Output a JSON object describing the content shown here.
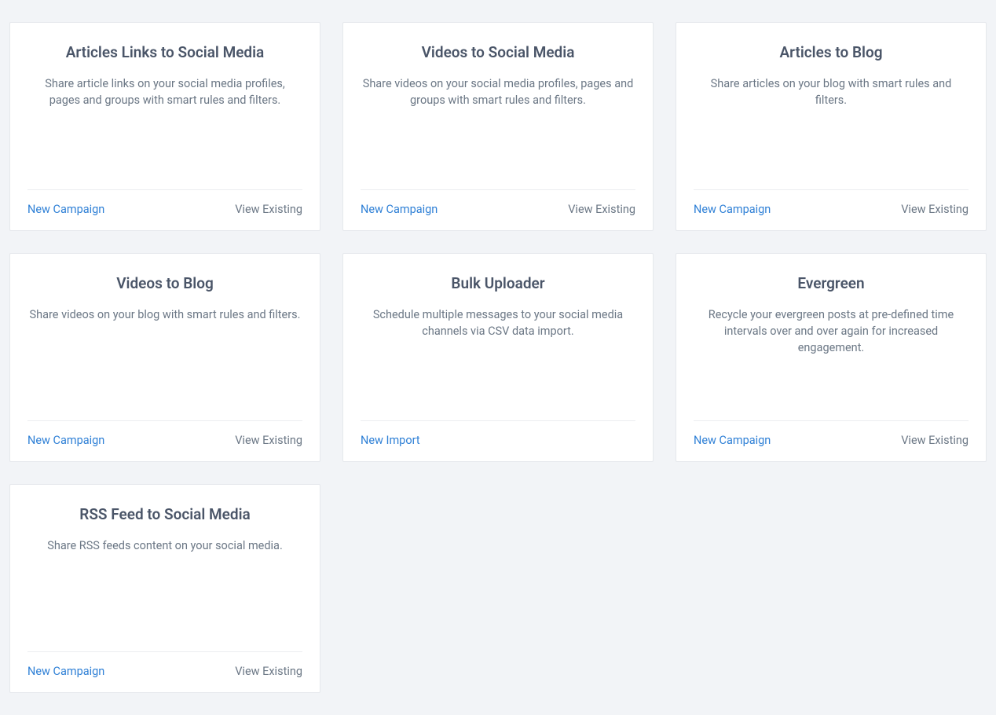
{
  "cards": [
    {
      "title": "Articles Links to Social Media",
      "desc": "Share article links on your social media profiles, pages and groups with smart rules and filters.",
      "primary": "New Campaign",
      "secondary": "View Existing"
    },
    {
      "title": "Videos to Social Media",
      "desc": "Share videos on your social media profiles, pages and groups with smart rules and filters.",
      "primary": "New Campaign",
      "secondary": "View Existing"
    },
    {
      "title": "Articles to Blog",
      "desc": "Share articles on your blog with smart rules and filters.",
      "primary": "New Campaign",
      "secondary": "View Existing"
    },
    {
      "title": "Videos to Blog",
      "desc": "Share videos on your blog with smart rules and filters.",
      "primary": "New Campaign",
      "secondary": "View Existing"
    },
    {
      "title": "Bulk Uploader",
      "desc": "Schedule multiple messages to your social media channels via CSV data import.",
      "primary": "New Import",
      "secondary": ""
    },
    {
      "title": "Evergreen",
      "desc": "Recycle your evergreen posts at pre-defined time intervals over and over again for increased engagement.",
      "primary": "New Campaign",
      "secondary": "View Existing"
    },
    {
      "title": "RSS Feed to Social Media",
      "desc": "Share RSS feeds content on your social media.",
      "primary": "New Campaign",
      "secondary": "View Existing"
    }
  ]
}
